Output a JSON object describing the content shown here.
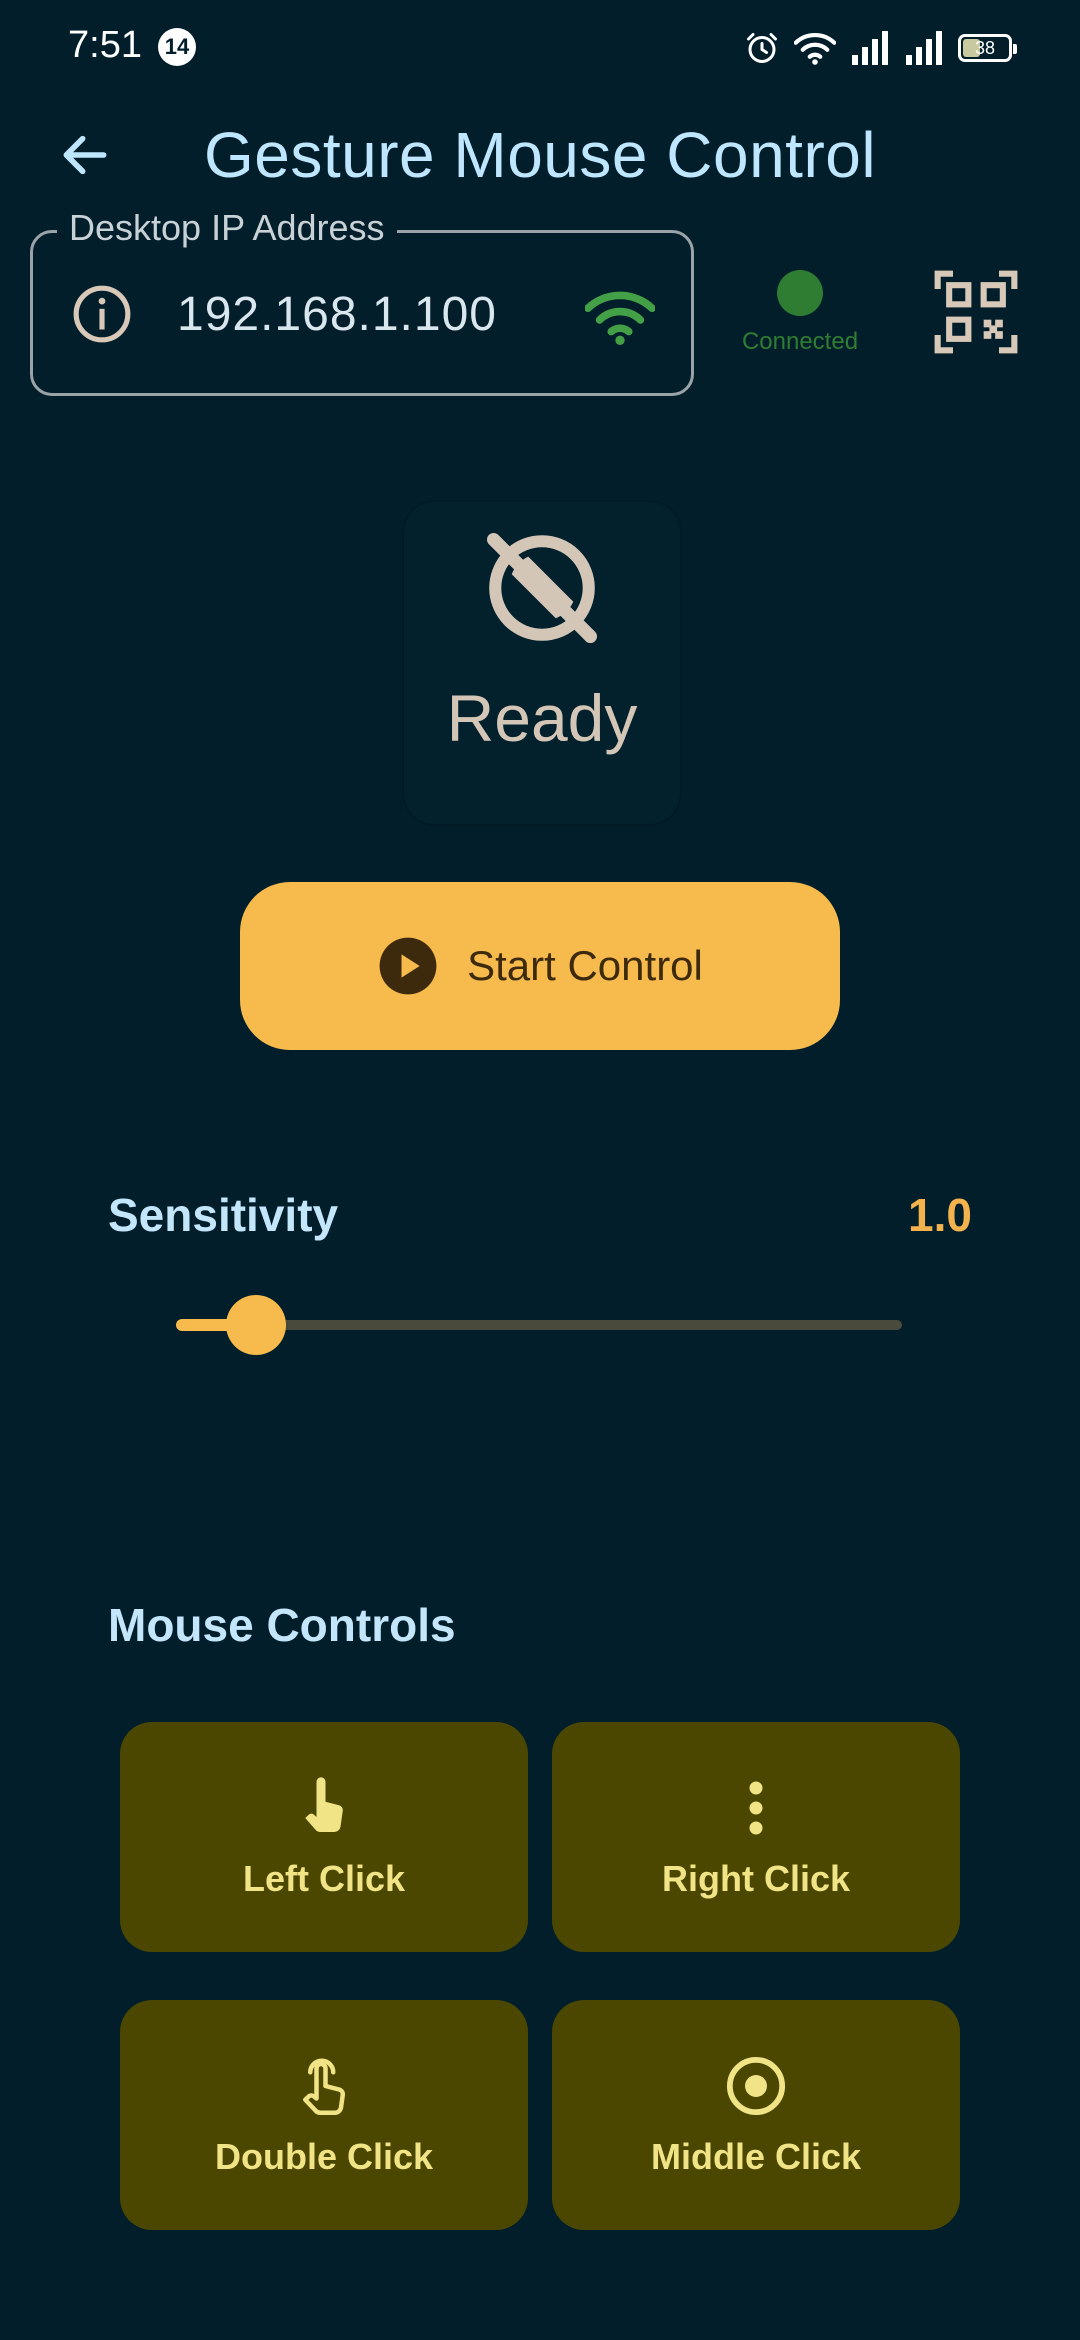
{
  "status_bar": {
    "time": "7:51",
    "notification_count": "14",
    "battery_level": "38",
    "battery_fraction": 0.38
  },
  "app_bar": {
    "title": "Gesture Mouse Control",
    "back_icon": "arrow-left-icon"
  },
  "ip_field": {
    "label": "Desktop IP Address",
    "value": "192.168.1.100",
    "leading_icon": "info-icon",
    "trailing_icon": "wifi-icon"
  },
  "connection": {
    "label": "Connected",
    "color": "#2e7d32"
  },
  "qr": {
    "icon": "qr-code-scanner-icon"
  },
  "status_card": {
    "label": "Ready",
    "icon": "motion-off-icon"
  },
  "start_button": {
    "label": "Start Control",
    "icon": "play-circle-icon",
    "color": "#f6bb4c"
  },
  "sensitivity": {
    "label": "Sensitivity",
    "value_text": "1.0",
    "level_fraction": 0.11
  },
  "mouse_controls": {
    "title": "Mouse Controls",
    "buttons": [
      {
        "label": "Left Click",
        "icon": "touch-app-icon"
      },
      {
        "label": "Right Click",
        "icon": "more-vert-icon"
      },
      {
        "label": "Double Click",
        "icon": "double-tap-icon"
      },
      {
        "label": "Middle Click",
        "icon": "radio-button-checked-icon"
      }
    ]
  }
}
